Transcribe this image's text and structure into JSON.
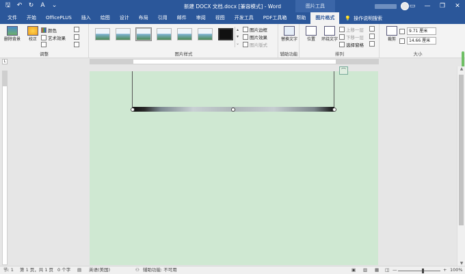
{
  "titlebar": {
    "doc_title": "新建 DOCX 文档.docx [兼容模式] - Word",
    "context_title": "图片工具",
    "min": "—",
    "restore": "❐",
    "close": "✕",
    "save": "🖫",
    "undo": "↶",
    "redo": "↻",
    "spell": "A",
    "more": "⌄"
  },
  "tabs": [
    "文件",
    "开始",
    "OfficePLUS",
    "插入",
    "绘图",
    "设计",
    "布局",
    "引用",
    "邮件",
    "审阅",
    "视图",
    "开发工具",
    "PDF工具箱",
    "帮助",
    "图片格式"
  ],
  "tellme": "操作说明搜索",
  "ribbon": {
    "adjust": {
      "label": "调整",
      "remove_bg": "删除背景",
      "corrections": "校正",
      "color": "颜色",
      "artistic": "艺术效果"
    },
    "styles": {
      "label": "图片样式",
      "border": "图片边框",
      "effects": "图片效果",
      "layout": "图片版式"
    },
    "accessibility": {
      "label": "辅助功能",
      "alt_text": "替换文字"
    },
    "arrange": {
      "label": "排列",
      "position": "位置",
      "wrap": "环绕文字",
      "forward": "上移一层",
      "backward": "下移一层",
      "select": "选择窗格"
    },
    "size": {
      "label": "大小",
      "crop": "裁剪",
      "height": "9.71 厘米",
      "width": "14.66 厘米"
    }
  },
  "statusbar": {
    "section": "节: 1",
    "page": "第 1 页，共 1 页",
    "words": "0 个字",
    "lang": "英语(美国)",
    "accessibility": "辅助功能: 不可用",
    "zoom": "100%",
    "minus": "—",
    "plus": "+"
  },
  "colors": {
    "brand": "#2b579a",
    "page": "#cfe8d2"
  }
}
